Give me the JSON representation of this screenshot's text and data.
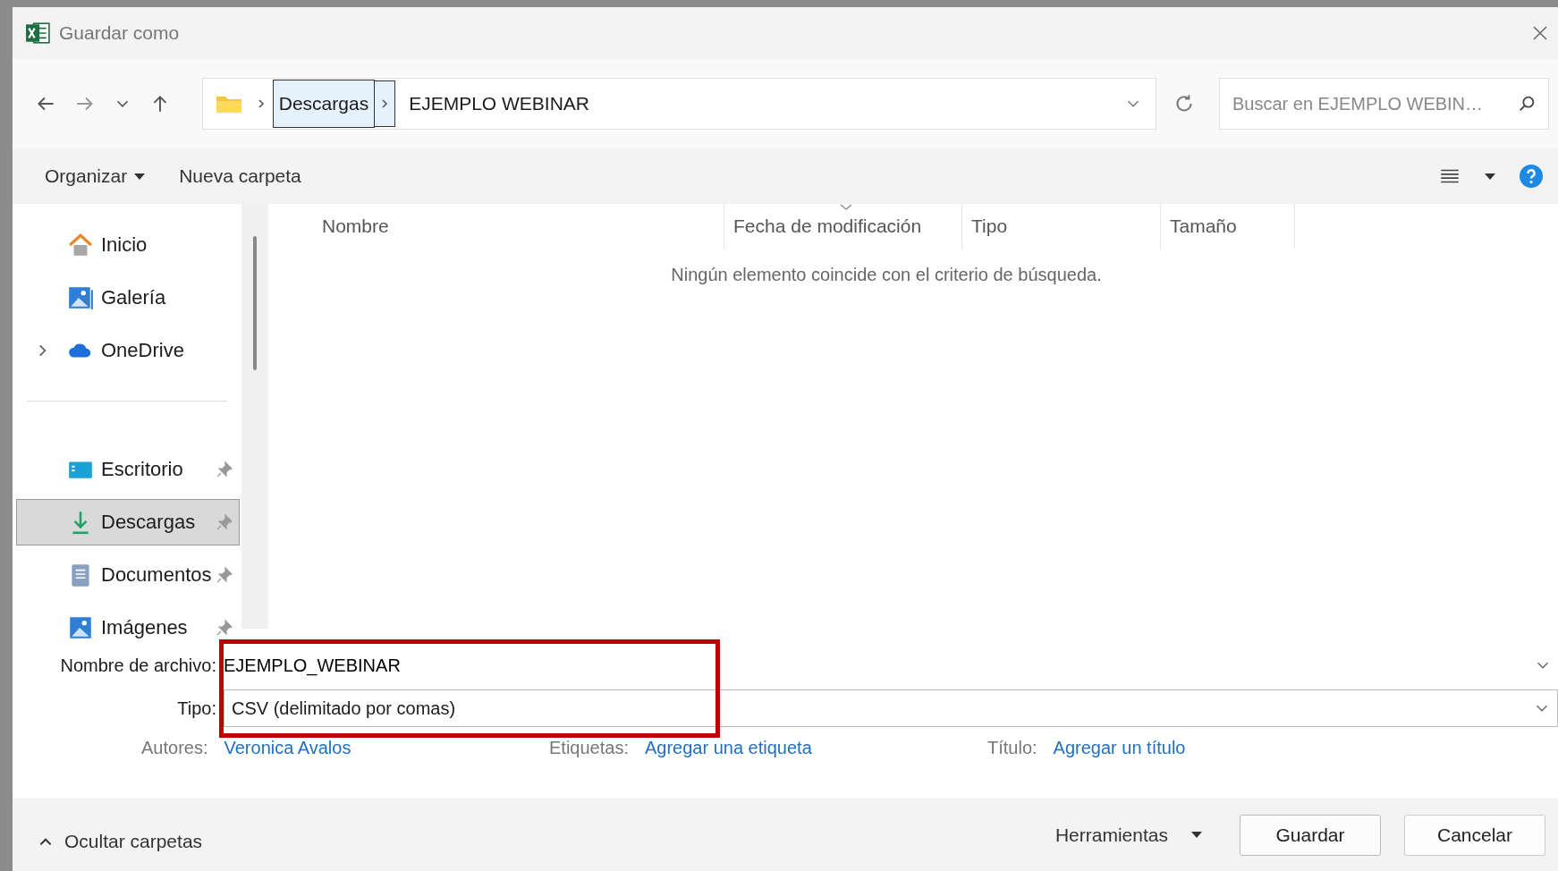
{
  "window": {
    "title": "Guardar como"
  },
  "address_bar": {
    "breadcrumbs": [
      {
        "label": "Descargas",
        "selected": true
      },
      {
        "label": "EJEMPLO WEBINAR",
        "selected": false
      }
    ]
  },
  "search": {
    "placeholder": "Buscar en EJEMPLO WEBIN…"
  },
  "toolbar": {
    "organize": "Organizar",
    "new_folder": "Nueva carpeta"
  },
  "nav": {
    "top": [
      {
        "label": "Inicio",
        "kind": "home",
        "expandable": false,
        "selected": false
      },
      {
        "label": "Galería",
        "kind": "gallery",
        "expandable": false,
        "selected": false
      },
      {
        "label": "OneDrive",
        "kind": "cloud",
        "expandable": true,
        "selected": false
      }
    ],
    "pinned": [
      {
        "label": "Escritorio",
        "kind": "desktop",
        "pinned": true,
        "selected": false
      },
      {
        "label": "Descargas",
        "kind": "download",
        "pinned": true,
        "selected": true
      },
      {
        "label": "Documentos",
        "kind": "document",
        "pinned": true,
        "selected": false
      },
      {
        "label": "Imágenes",
        "kind": "pictures",
        "pinned": true,
        "selected": false
      }
    ]
  },
  "columns": [
    {
      "label": "Nombre",
      "sorted": false
    },
    {
      "label": "Fecha de modificación",
      "sorted": true
    },
    {
      "label": "Tipo",
      "sorted": false
    },
    {
      "label": "Tamaño",
      "sorted": false
    }
  ],
  "empty_message": "Ningún elemento coincide con el criterio de búsqueda.",
  "file_name": {
    "label": "Nombre de archivo:",
    "value": "EJEMPLO_WEBINAR"
  },
  "file_type": {
    "label": "Tipo:",
    "value": "CSV (delimitado por comas)"
  },
  "metadata": [
    {
      "label": "Autores:",
      "value": "Veronica Avalos"
    },
    {
      "label": "Etiquetas:",
      "value": "Agregar una etiqueta"
    },
    {
      "label": "Título:",
      "value": "Agregar un título"
    }
  ],
  "hide_folders": "Ocultar carpetas",
  "tools": "Herramientas",
  "buttons": [
    {
      "label": "Guardar",
      "kind": "primary"
    },
    {
      "label": "Cancelar",
      "kind": "secondary"
    }
  ]
}
